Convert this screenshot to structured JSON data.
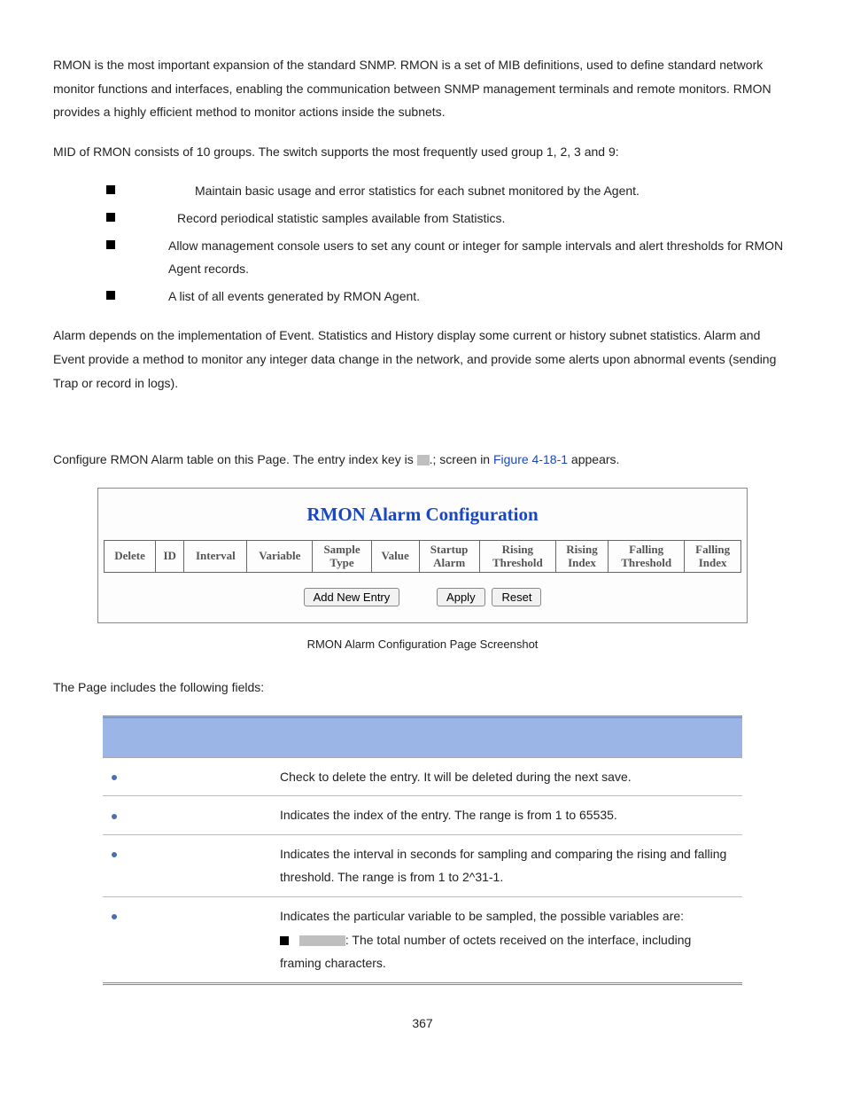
{
  "intro_p1": "RMON is the most important expansion of the standard SNMP. RMON is a set of MIB definitions, used to define standard network monitor functions and interfaces, enabling the communication between SNMP management terminals and remote monitors. RMON provides a highly efficient method to monitor actions inside the subnets.",
  "intro_p2": "MID of RMON consists of 10 groups. The switch supports the most frequently used group 1, 2, 3 and 9:",
  "bullets": [
    "Maintain basic usage and error statistics for each subnet monitored by the Agent.",
    "Record periodical statistic samples available from Statistics.",
    "Allow management console users to set any count or integer for sample intervals and alert thresholds for RMON Agent records.",
    "A list of all events generated by RMON Agent."
  ],
  "intro_p3": "Alarm depends on the implementation of Event. Statistics and History display some current or history subnet statistics. Alarm and Event provide a method to monitor any integer data change in the network, and provide some alerts upon abnormal events (sending Trap or record in logs).",
  "config_line_pre": "Configure RMON Alarm table on this Page. The entry index key is ",
  "config_line_mid": ".; screen in ",
  "config_line_link": "Figure 4-18-1",
  "config_line_post": " appears.",
  "screenshot": {
    "title": "RMON Alarm Configuration",
    "headers": [
      "Delete",
      "ID",
      "Interval",
      "Variable",
      "Sample Type",
      "Value",
      "Startup Alarm",
      "Rising Threshold",
      "Rising Index",
      "Falling Threshold",
      "Falling Index"
    ],
    "buttons": {
      "add": "Add New Entry",
      "apply": "Apply",
      "reset": "Reset"
    }
  },
  "caption": "RMON Alarm Configuration Page Screenshot",
  "fields_intro": "The Page includes the following fields:",
  "fields": [
    {
      "desc": "Check to delete the entry. It will be deleted during the next save."
    },
    {
      "desc": "Indicates the index of the entry. The range is from 1 to 65535."
    },
    {
      "desc": "Indicates the interval in seconds for sampling and comparing the rising and falling threshold. The range is from 1 to 2^31-1."
    },
    {
      "desc_line1": "Indicates the particular variable to be sampled, the possible variables are:",
      "sub_tail": ": The total number of octets received on the interface, including framing characters."
    }
  ],
  "page_number": "367"
}
